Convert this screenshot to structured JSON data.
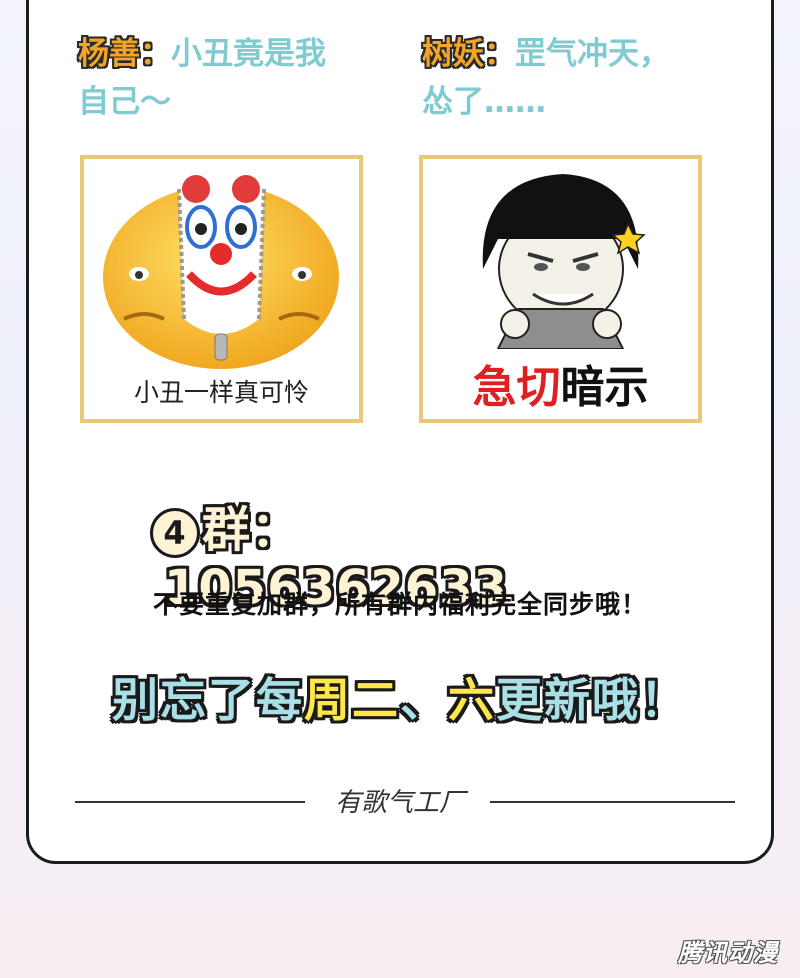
{
  "comments": [
    {
      "author": "杨善：",
      "line1": "小丑竟是我",
      "line2": "自己～"
    },
    {
      "author": "树妖：",
      "line1": "罡气冲天，",
      "line2": "怂了……"
    }
  ],
  "memes": [
    {
      "caption": "小丑一样真可怜"
    },
    {
      "caption_red": "急切",
      "caption_black": "暗示"
    }
  ],
  "group": {
    "badge": "4",
    "label": "群：",
    "number": "1056362633"
  },
  "notice": "不要重复加群，所有群内福利完全同步哦！",
  "reminder": {
    "part1": "别忘了每",
    "part2": "周二",
    "part3": "、",
    "part4": "六",
    "part5": "更新哦！"
  },
  "studio": "有歌气工厂",
  "watermark": "腾讯动漫",
  "colors": {
    "comment_text": "#7fcbd1",
    "author": "#f3a52a",
    "frame": "#e9c979",
    "highlight": "#ffe74a"
  }
}
